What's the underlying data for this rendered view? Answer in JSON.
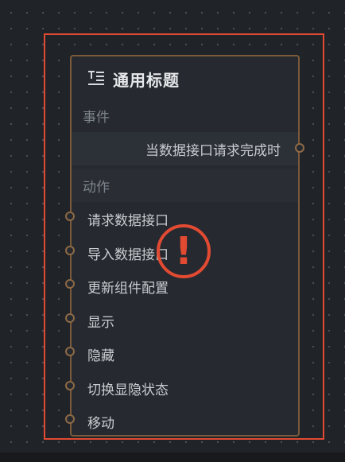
{
  "node": {
    "icon": "title-text-icon",
    "title": "通用标题",
    "events_label": "事件",
    "events": [
      {
        "label": "当数据接口请求完成时"
      }
    ],
    "actions_label": "动作",
    "actions": [
      {
        "label": "请求数据接口"
      },
      {
        "label": "导入数据接口"
      },
      {
        "label": "更新组件配置"
      },
      {
        "label": "显示"
      },
      {
        "label": "隐藏"
      },
      {
        "label": "切换显隐状态"
      },
      {
        "label": "移动"
      }
    ],
    "status": {
      "icon": "error-exclamation-icon",
      "symbol": "!"
    }
  },
  "colors": {
    "canvas_bg": "#202327",
    "node_bg": "#262a30",
    "node_border": "#7a5a3a",
    "selection_border": "#e24a32",
    "error": "#e24a32",
    "port": "#8e6a45"
  }
}
